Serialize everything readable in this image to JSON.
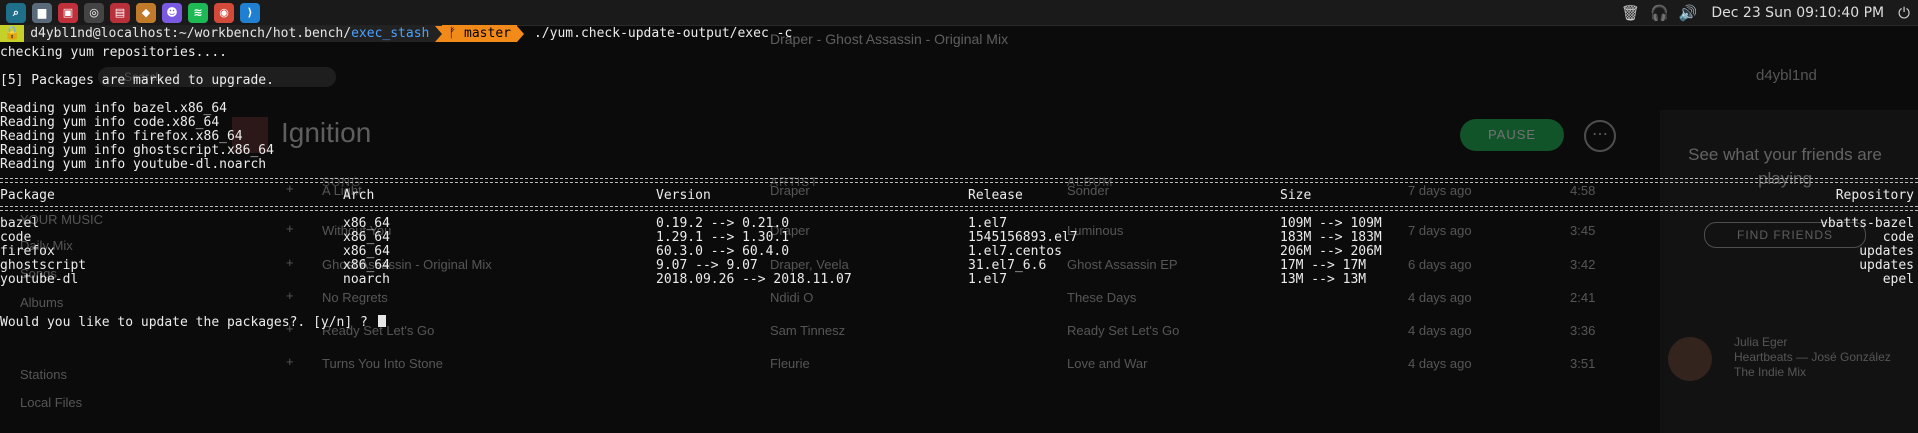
{
  "taskbar": {
    "apps": [
      {
        "name": "krunner",
        "glyph": "⌕",
        "color": "#1f6f8b"
      },
      {
        "name": "files",
        "glyph": "▆",
        "color": "#5a6a7a"
      },
      {
        "name": "terminal",
        "glyph": "▣",
        "color": "#c0303a"
      },
      {
        "name": "obs",
        "glyph": "◎",
        "color": "#444"
      },
      {
        "name": "notes",
        "glyph": "▤",
        "color": "#b8303a"
      },
      {
        "name": "package",
        "glyph": "◆",
        "color": "#c07a2a"
      },
      {
        "name": "discord",
        "glyph": "☻",
        "color": "#7a5ae0"
      },
      {
        "name": "spotify",
        "glyph": "≋",
        "color": "#1db954"
      },
      {
        "name": "chrome",
        "glyph": "◉",
        "color": "#d44a3a"
      },
      {
        "name": "vscode",
        "glyph": "⟩",
        "color": "#1f7fd0"
      }
    ],
    "clock": "Dec 23 Sun 09:10:40 PM"
  },
  "background_app": {
    "now_playing": "Draper - Ghost Assassin - Original Mix",
    "search_placeholder": "Search",
    "playlist_title": "Ignition",
    "pause_label": "PAUSE",
    "user_name": "d4ybl1nd",
    "friends_text": "See what your friends are playing",
    "find_friends": "FIND FRIENDS",
    "sidebar": [
      "YOUR MUSIC",
      "Daily Mix",
      "Songs",
      "Albums",
      "Stations",
      "Local Files"
    ],
    "columns": {
      "song": "SONG",
      "artist": "ARTIST",
      "album": "ALBUM"
    },
    "rows": [
      {
        "song": "A Light",
        "artist": "Draper",
        "album": "Sonder",
        "date": "7 days ago",
        "time": "4:58"
      },
      {
        "song": "Without You",
        "artist": "Draper",
        "album": "Luminous",
        "date": "7 days ago",
        "time": "3:45"
      },
      {
        "song": "Ghost Assassin - Original Mix",
        "artist": "Draper, Veela",
        "album": "Ghost Assassin EP",
        "date": "6 days ago",
        "time": "3:42"
      },
      {
        "song": "No Regrets",
        "artist": "Ndidi O",
        "album": "These Days",
        "date": "4 days ago",
        "time": "2:41"
      },
      {
        "song": "Ready Set Let's Go",
        "artist": "Sam Tinnesz",
        "album": "Ready Set Let's Go",
        "date": "4 days ago",
        "time": "3:36"
      },
      {
        "song": "Turns You Into Stone",
        "artist": "Fleurie",
        "album": "Love and War",
        "date": "4 days ago",
        "time": "3:51"
      }
    ],
    "friend_activity": {
      "name": "Julia Eger",
      "track": "Heartbeats — José González",
      "source": "The Indie Mix"
    }
  },
  "terminal": {
    "prompt_user": "d4ybl1nd@localhost:~/workbench/hot.bench/",
    "prompt_dir": "exec_stash",
    "branch": "master",
    "command": "./yum.check-update-output/exec -c",
    "lines": [
      "checking yum repositories....",
      "",
      "[5] Packages are marked to upgrade.",
      "",
      "Reading yum info bazel.x86_64",
      "Reading yum info code.x86_64",
      "Reading yum info firefox.x86_64",
      "Reading yum info ghostscript.x86_64",
      "Reading yum info youtube-dl.noarch"
    ],
    "table": {
      "headers": [
        "Package",
        "Arch",
        "Version",
        "Release",
        "Size",
        "Repository"
      ],
      "rows": [
        [
          "bazel",
          "x86_64",
          "0.19.2 --> 0.21.0",
          "1.el7",
          "109M --> 109M",
          "vbatts-bazel"
        ],
        [
          "code",
          "x86_64",
          "1.29.1 --> 1.30.1",
          "1545156893.el7",
          "183M --> 183M",
          "code"
        ],
        [
          "firefox",
          "x86_64",
          "60.3.0 --> 60.4.0",
          "1.el7.centos",
          "206M --> 206M",
          "updates"
        ],
        [
          "ghostscript",
          "x86_64",
          "9.07 --> 9.07",
          "31.el7_6.6",
          "17M --> 17M",
          "updates"
        ],
        [
          "youtube-dl",
          "noarch",
          "2018.09.26 --> 2018.11.07",
          "1.el7",
          "13M --> 13M",
          "epel"
        ]
      ]
    },
    "question": "Would you like to update the packages?. [y/n] ?"
  }
}
